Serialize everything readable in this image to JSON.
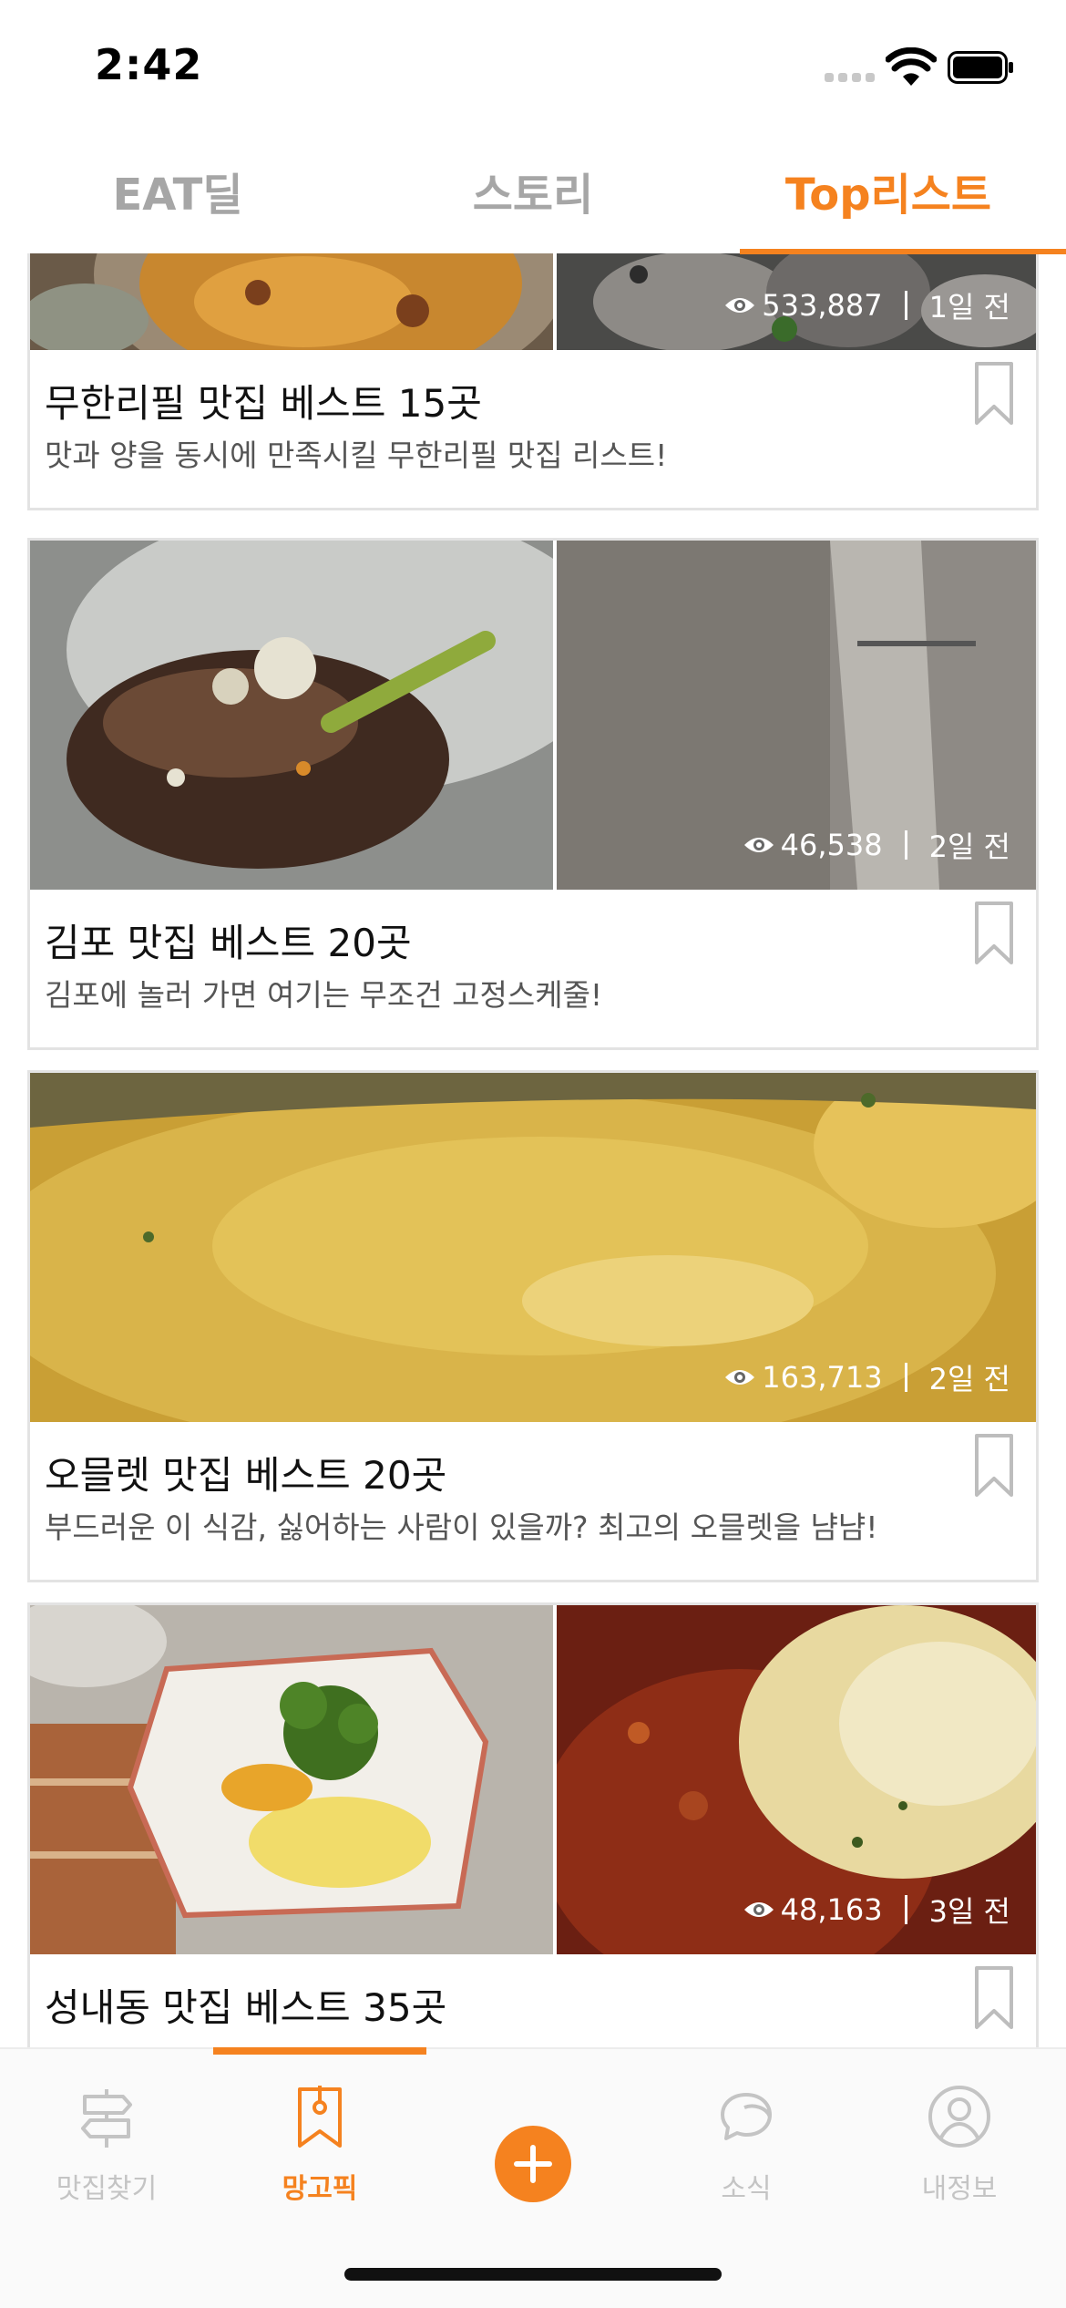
{
  "status_bar": {
    "time": "2:42"
  },
  "top_tabs": [
    {
      "label": "EAT딜",
      "active": false
    },
    {
      "label": "스토리",
      "active": false
    },
    {
      "label": "Top리스트",
      "active": true
    }
  ],
  "cards": [
    {
      "title": "무한리필 맛집 베스트 15곳",
      "description": "맛과 양을 동시에 만족시킬 무한리필 맛집 리스트!",
      "views": "533,887",
      "time_ago": "1일 전",
      "icon": "bookmark-icon"
    },
    {
      "title": "김포 맛집 베스트 20곳",
      "description": "김포에 놀러 가면 여기는 무조건 고정스케줄!",
      "views": "46,538",
      "time_ago": "2일 전",
      "icon": "bookmark-icon"
    },
    {
      "title": "오믈렛 맛집 베스트 20곳",
      "description": "부드러운 이 식감, 싫어하는 사람이 있을까? 최고의 오믈렛을 냠냠!",
      "views": "163,713",
      "time_ago": "2일 전",
      "icon": "bookmark-icon"
    },
    {
      "title": "성내동 맛집 베스트 35곳",
      "description": "",
      "views": "48,163",
      "time_ago": "3일 전",
      "icon": "bookmark-icon"
    }
  ],
  "bottom_nav": [
    {
      "label": "맛집찾기",
      "icon": "signpost-icon",
      "active": false
    },
    {
      "label": "망고픽",
      "icon": "bookmark-tag-icon",
      "active": true
    },
    {
      "label": "",
      "icon": "plus-icon",
      "active": false
    },
    {
      "label": "소식",
      "icon": "chat-bubble-icon",
      "active": false
    },
    {
      "label": "내정보",
      "icon": "profile-icon",
      "active": false
    }
  ],
  "colors": {
    "accent": "#f5821f",
    "inactive": "#a6a6a6",
    "nav_inactive": "#c4c4c4"
  }
}
